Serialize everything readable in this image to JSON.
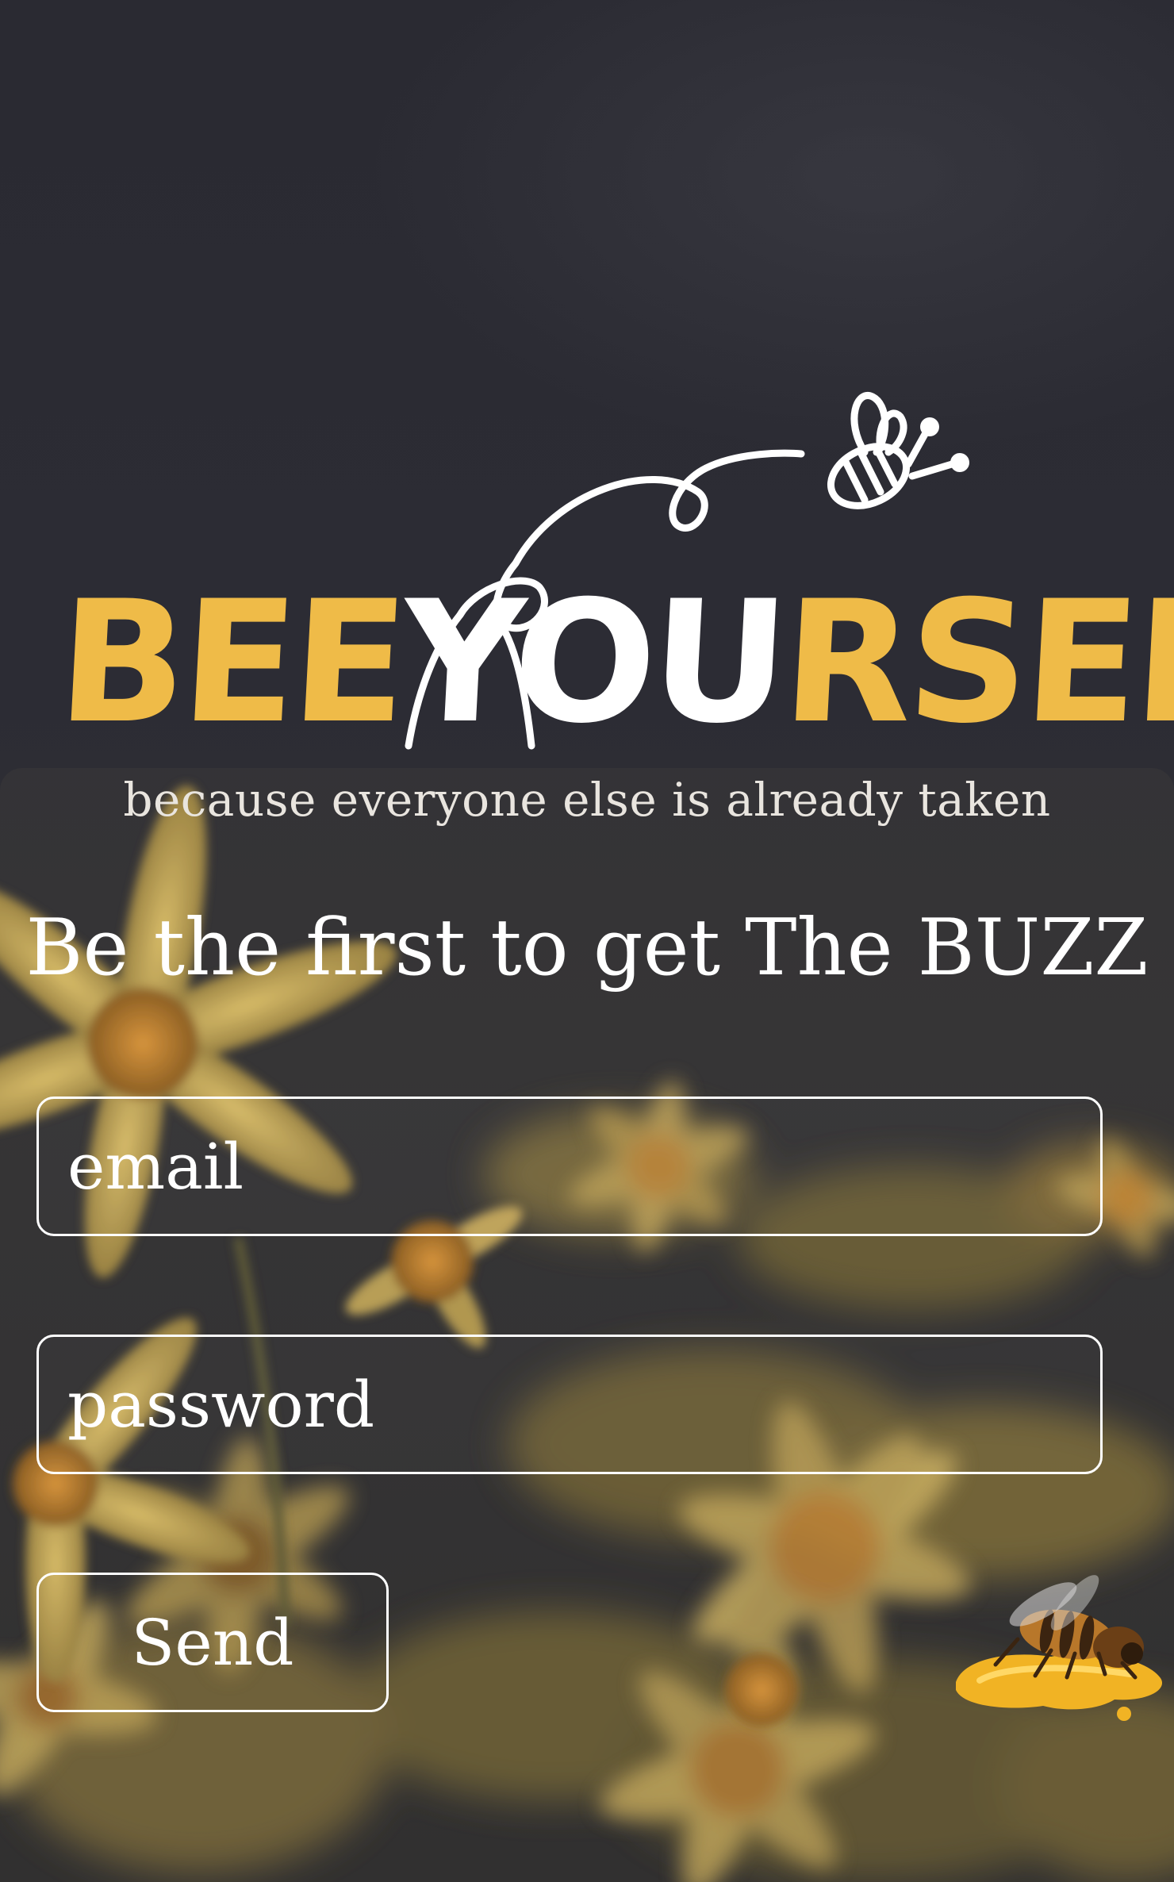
{
  "logo": {
    "word_part1": "BEE",
    "word_part2": "YOU",
    "word_part3": "RSELF",
    "icon": "flying-bee-icon",
    "tagline": "because everyone else is already taken"
  },
  "heading": "Be the first to get The BUZZ",
  "form": {
    "email_placeholder": "email",
    "password_placeholder": "password",
    "send_label": "Send"
  },
  "decoration": {
    "icon": "bee-on-honey-icon"
  },
  "colors": {
    "brand_yellow": "#efbb48",
    "text": "#ffffff",
    "background": "#2b2b33"
  }
}
